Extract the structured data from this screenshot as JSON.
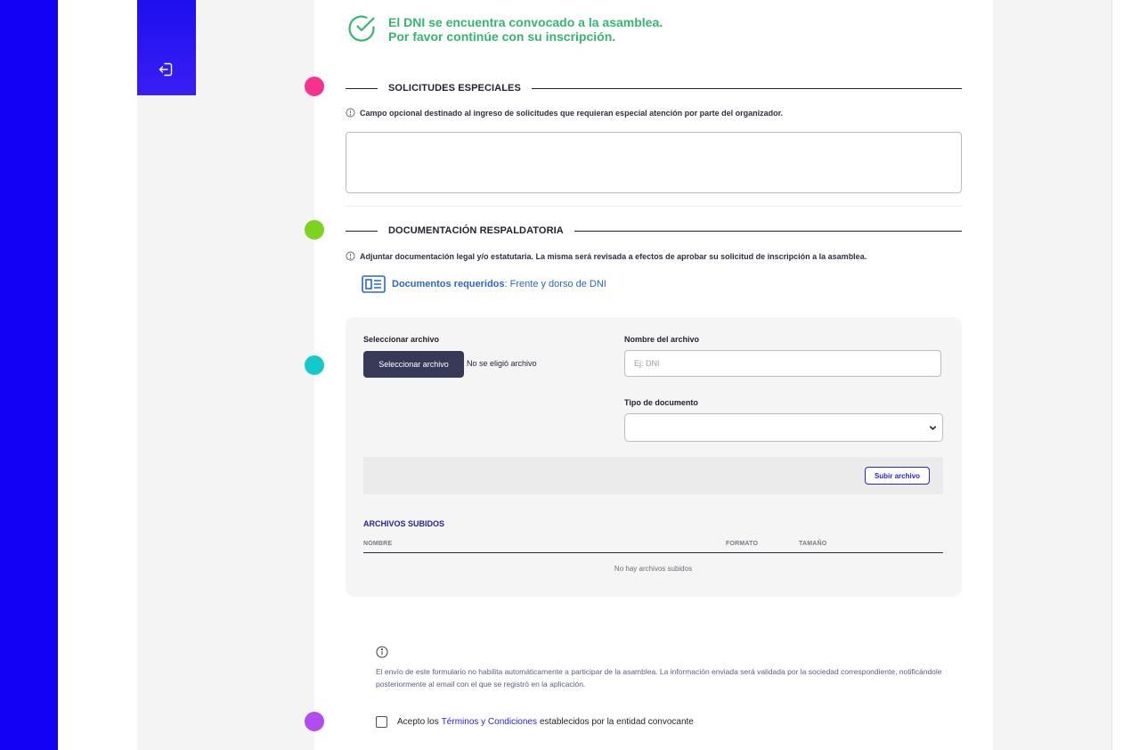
{
  "status": {
    "line1": "El DNI se encuentra convocado a la asamblea.",
    "line2": "Por favor continúe con su inscripción.",
    "color": "#35b56f"
  },
  "sidebar": {
    "logout_icon": "logout-icon"
  },
  "colors": {
    "leftbar": "#1200f5",
    "dot_pink": "#f5338f",
    "dot_green": "#7ed321",
    "dot_teal": "#14c9c9",
    "dot_purple": "#b04cf0",
    "accent": "#2a22d8"
  },
  "special_requests": {
    "title": "SOLICITUDES ESPECIALES",
    "hint": "Campo opcional destinado al ingreso de solicitudes que requieran especial atención por parte del organizador.",
    "textarea_value": ""
  },
  "documentation": {
    "title": "DOCUMENTACIÓN RESPALDATORIA",
    "hint": "Adjuntar documentación legal y/o estatutaria. La misma será revisada a efectos de aprobar su solicitud de inscripción a la asamblea.",
    "required_label": "Documentos requeridos",
    "required_value": "Frente y dorso de DNI"
  },
  "upload": {
    "select_file_label": "Seleccionar archivo",
    "select_file_button": "Seleccionar archivo",
    "file_status": "No se eligió archivo",
    "name_label": "Nombre del archivo",
    "name_placeholder": "Ej: DNI",
    "doc_type_label": "Tipo de documento",
    "doc_type_value": "",
    "upload_button": "Subir archivo"
  },
  "uploaded_files": {
    "title": "ARCHIVOS SUBIDOS",
    "columns": [
      "NOMBRE",
      "FORMATO",
      "TAMAÑO"
    ],
    "empty": "No hay archivos subidos"
  },
  "notice": {
    "text": "El envío de este formulario no habilita automáticamente a participar de la asamblea. La información enviada será validada por la sociedad correspondiente, notificándole posteriormente al email con el que se registró en la aplicación."
  },
  "terms": {
    "prefix": "Acepto los",
    "link": "Términos y Condiciones",
    "suffix": "establecidos por la entidad convocante",
    "checked": false
  }
}
